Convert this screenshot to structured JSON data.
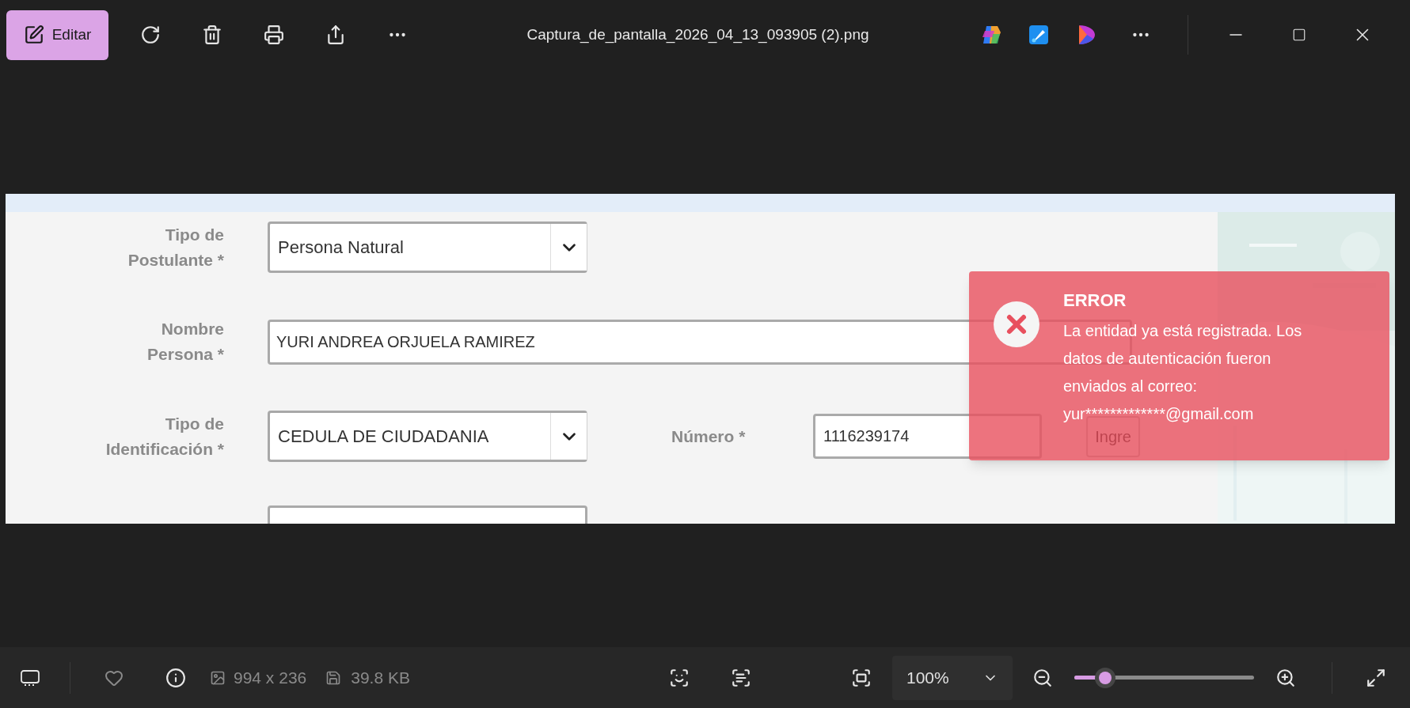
{
  "toolbar": {
    "edit_button": "Editar",
    "file_title": "Captura_de_pantalla_2026_04_13_093905 (2).png"
  },
  "form": {
    "rows": [
      {
        "kind": "select",
        "label_lines": [
          "Tipo de",
          "Postulante *"
        ],
        "value": "Persona Natural"
      },
      {
        "kind": "text",
        "label_lines": [
          "Nombre",
          "Persona *"
        ],
        "value": "YURI ANDREA ORJUELA RAMIREZ"
      },
      {
        "kind": "select_number",
        "label_lines": [
          "Tipo de",
          "Identificación *"
        ],
        "value": "CEDULA DE CIUDADANIA",
        "number_label": "Número *",
        "number_value": "1116239174",
        "button": "Ingre"
      }
    ]
  },
  "toast": {
    "title": "ERROR",
    "message": "La entidad ya está registrada. Los datos de autenticación fueron enviados al correo: yur*************@gmail.com"
  },
  "status_bar": {
    "dimensions": "994 x 236",
    "file_size": "39.8 KB",
    "zoom": "100%",
    "zoom_slider": {
      "level": 0.17
    }
  }
}
